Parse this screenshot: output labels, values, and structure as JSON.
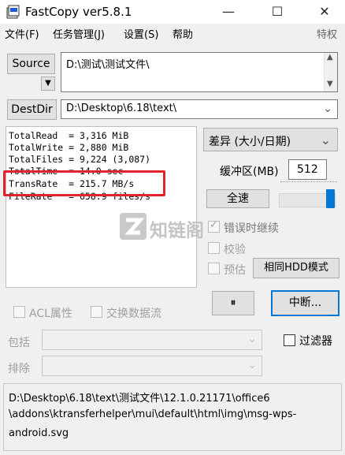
{
  "window": {
    "title": "FastCopy ver5.8.1",
    "controls": [
      "—",
      "☐",
      "✕"
    ]
  },
  "menu": {
    "items": [
      "文件(F)",
      "任务管理(J)",
      "设置(S)",
      "帮助"
    ],
    "right_label": "特权"
  },
  "source": {
    "button": "Source",
    "path": "D:\\测试\\测试文件\\"
  },
  "destdir": {
    "button": "DestDir",
    "path": "D:\\Desktop\\6.18\\text\\"
  },
  "stats": [
    "TotalRead  = 3,316 MiB",
    "TotalWrite = 2,880 MiB",
    "TotalFiles = 9,224 (3,087)",
    "TotalTime  = 14.0 sec",
    "TransRate  = 215.7 MB/s",
    "FileRate   = 658.9 files/s"
  ],
  "mode": {
    "selected": "差异 (大小/日期)"
  },
  "buffer": {
    "label": "缓冲区(MB)",
    "value": "512"
  },
  "speed": {
    "label": "全速",
    "level": 1.0
  },
  "watermark": {
    "text": "知链阁"
  },
  "options": {
    "continue_on_error": "错误时继续",
    "verify": "校验",
    "estimate": "预估",
    "hdd_mode": "相同HDD模式"
  },
  "controls": {
    "pause": "⏸",
    "stop": "中断..."
  },
  "streams": {
    "acl": "ACL属性",
    "ads": "交换数据流"
  },
  "filters": {
    "include_label": "包括",
    "exclude_label": "排除",
    "filter_checkbox": "过滤器"
  },
  "status": {
    "path_lines": [
      "D:\\Desktop\\6.18\\text\\测试文件\\12.1.0.21171\\office6",
      "\\addons\\ktransferhelper\\mui\\default\\html\\img\\msg-wps-",
      "android.svg"
    ]
  }
}
